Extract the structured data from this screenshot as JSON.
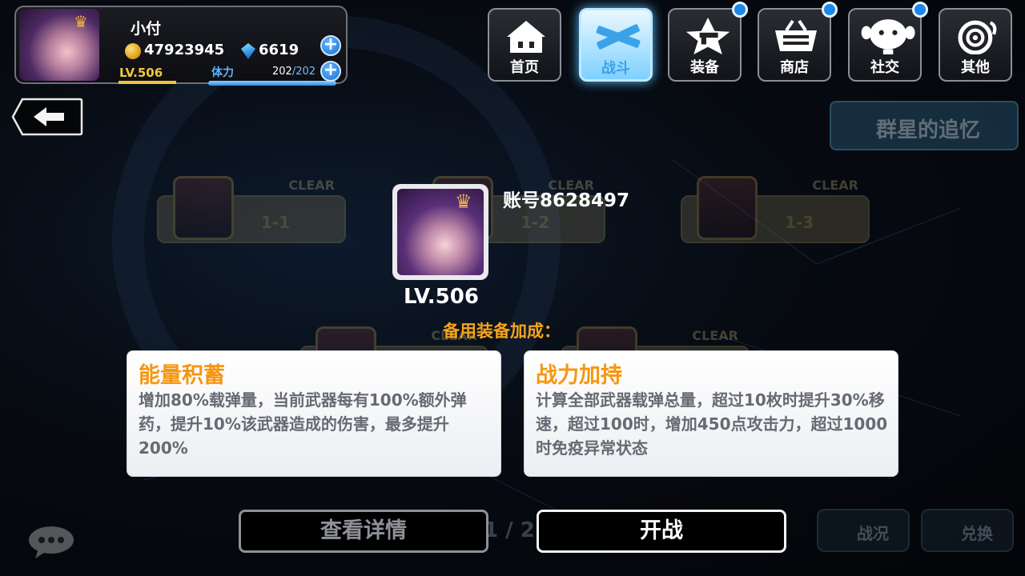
{
  "player": {
    "name": "小付",
    "gold": "47923945",
    "gems": "6619",
    "level_text": "LV.506",
    "stamina_label": "体力",
    "stamina_current": "202",
    "stamina_max": "/202",
    "stamina_fraction": 1.0
  },
  "nav": {
    "items": [
      {
        "label": "首页",
        "icon": "house-icon",
        "active": false,
        "badge": false
      },
      {
        "label": "战斗",
        "icon": "crossed-guns-icon",
        "active": true,
        "badge": false
      },
      {
        "label": "装备",
        "icon": "star-gun-icon",
        "active": false,
        "badge": true
      },
      {
        "label": "商店",
        "icon": "basket-icon",
        "active": false,
        "badge": true
      },
      {
        "label": "社交",
        "icon": "ghost-face-icon",
        "active": false,
        "badge": true
      },
      {
        "label": "其他",
        "icon": "spiral-icon",
        "active": false,
        "badge": false
      }
    ]
  },
  "background": {
    "stage_name": "群星的追忆",
    "nodes": [
      {
        "clear": "CLEAR",
        "label": "1-1"
      },
      {
        "clear": "CLEAR",
        "label": "1-2"
      },
      {
        "clear": "CLEAR",
        "label": "1-3"
      },
      {
        "clear": "CLEAR",
        "label": ""
      },
      {
        "clear": "CLEAR",
        "label": ""
      }
    ],
    "pager": "1 / 2",
    "battle_status_label": "战况",
    "exchange_label": "兑换"
  },
  "popup": {
    "account": "账号8628497",
    "level": "LV.506",
    "bonus_title": "备用装备加成：",
    "cards": [
      {
        "title": "能量积蓄",
        "desc": "增加80%载弹量，当前武器每有100%额外弹药，提升10%该武器造成的伤害，最多提升200%"
      },
      {
        "title": "战力加持",
        "desc": "计算全部武器载弹总量，超过10枚时提升30%移速，超过100时，增加450点攻击力，超过1000时免疫异常状态"
      }
    ],
    "view_details": "查看详情",
    "start_battle": "开战"
  },
  "colors": {
    "accent_orange": "#f6a417",
    "level_gold": "#f2c83a",
    "stamina_blue": "#5fb3ff",
    "active_tab": "#3aa2e8"
  }
}
